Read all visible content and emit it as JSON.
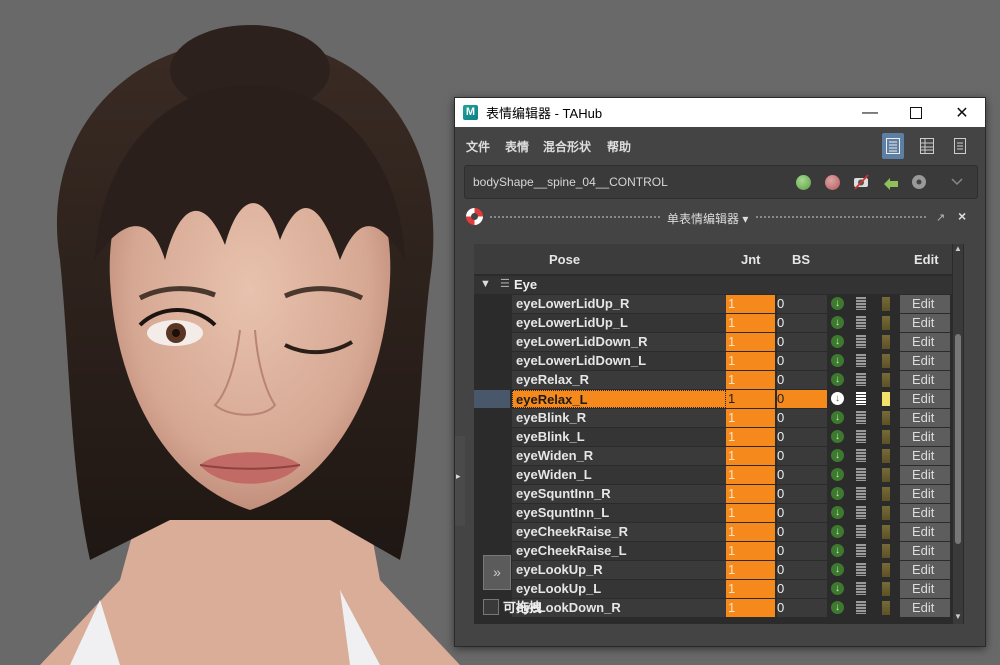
{
  "window": {
    "app_icon": "M",
    "title": "表情编辑器 - TAHub",
    "minimize_icon": "minimize-icon",
    "maximize_icon": "maximize-icon",
    "close_icon": "close-icon"
  },
  "menu": {
    "items": [
      "文件",
      "表情",
      "混合形状",
      "帮助"
    ]
  },
  "layout_buttons": [
    "layout-list-icon",
    "layout-grid-icon",
    "layout-detail-icon"
  ],
  "toolbar": {
    "shape_name": "bodyShape__spine_04__CONTROL",
    "buttons": [
      "green-dot-icon",
      "red-dot-icon",
      "no-camera-icon",
      "link-arrow-icon",
      "disc-icon"
    ],
    "dropdown_icon": "chevron-down-icon"
  },
  "panel": {
    "title": "单表情编辑器 ▾",
    "float_icon": "float-icon",
    "close_label": "×"
  },
  "table": {
    "headers": {
      "pose": "Pose",
      "jnt": "Jnt",
      "bs": "BS",
      "edit": "Edit"
    },
    "group": {
      "arrow": "▼",
      "icon": "☰",
      "label": "Eye"
    },
    "rows": [
      {
        "name": "eyeLowerLidUp_R",
        "jnt": "1",
        "bs": "0",
        "edit": "Edit"
      },
      {
        "name": "eyeLowerLidUp_L",
        "jnt": "1",
        "bs": "0",
        "edit": "Edit"
      },
      {
        "name": "eyeLowerLidDown_R",
        "jnt": "1",
        "bs": "0",
        "edit": "Edit"
      },
      {
        "name": "eyeLowerLidDown_L",
        "jnt": "1",
        "bs": "0",
        "edit": "Edit"
      },
      {
        "name": "eyeRelax_R",
        "jnt": "1",
        "bs": "0",
        "edit": "Edit"
      },
      {
        "name": "eyeRelax_L",
        "jnt": "1",
        "bs": "0",
        "edit": "Edit",
        "selected": true
      },
      {
        "name": "eyeBlink_R",
        "jnt": "1",
        "bs": "0",
        "edit": "Edit"
      },
      {
        "name": "eyeBlink_L",
        "jnt": "1",
        "bs": "0",
        "edit": "Edit"
      },
      {
        "name": "eyeWiden_R",
        "jnt": "1",
        "bs": "0",
        "edit": "Edit"
      },
      {
        "name": "eyeWiden_L",
        "jnt": "1",
        "bs": "0",
        "edit": "Edit"
      },
      {
        "name": "eyeSquntInn_R",
        "jnt": "1",
        "bs": "0",
        "edit": "Edit"
      },
      {
        "name": "eyeSquntInn_L",
        "jnt": "1",
        "bs": "0",
        "edit": "Edit"
      },
      {
        "name": "eyeCheekRaise_R",
        "jnt": "1",
        "bs": "0",
        "edit": "Edit"
      },
      {
        "name": "eyeCheekRaise_L",
        "jnt": "1",
        "bs": "0",
        "edit": "Edit"
      },
      {
        "name": "eyeLookUp_R",
        "jnt": "1",
        "bs": "0",
        "edit": "Edit"
      },
      {
        "name": "eyeLookUp_L",
        "jnt": "1",
        "bs": "0",
        "edit": "Edit"
      },
      {
        "name": "eyeLookDown_R",
        "jnt": "1",
        "bs": "0",
        "edit": "Edit"
      }
    ]
  },
  "expand_button": "»",
  "drag_checkbox": {
    "label": "可拖拽",
    "checked": false
  },
  "colors": {
    "accent_orange": "#f5891b",
    "selection_blue": "#5d7fa3",
    "panel_bg": "#444444",
    "viewport_bg": "#696969"
  }
}
